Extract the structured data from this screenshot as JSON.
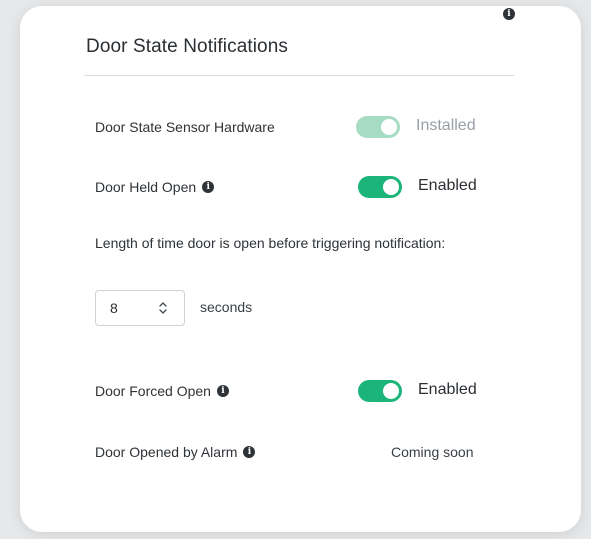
{
  "header": {
    "title": "Door State Notifications",
    "info_icon": "info-icon"
  },
  "rows": {
    "sensor": {
      "label": "Door State Sensor Hardware",
      "toggle_on": true,
      "toggle_enabled": false,
      "status": "Installed"
    },
    "held_open": {
      "label": "Door Held Open",
      "toggle_on": true,
      "status": "Enabled"
    },
    "forced_open": {
      "label": "Door Forced Open",
      "toggle_on": true,
      "status": "Enabled"
    },
    "opened_by_alarm": {
      "label": "Door Opened by Alarm",
      "status": "Coming soon"
    }
  },
  "held_open_time": {
    "description": "Length of time door is open before triggering notification:",
    "value": "8",
    "unit": "seconds"
  },
  "colors": {
    "toggle_active": "#1bb57a",
    "toggle_disabled": "#a6dcc4"
  }
}
